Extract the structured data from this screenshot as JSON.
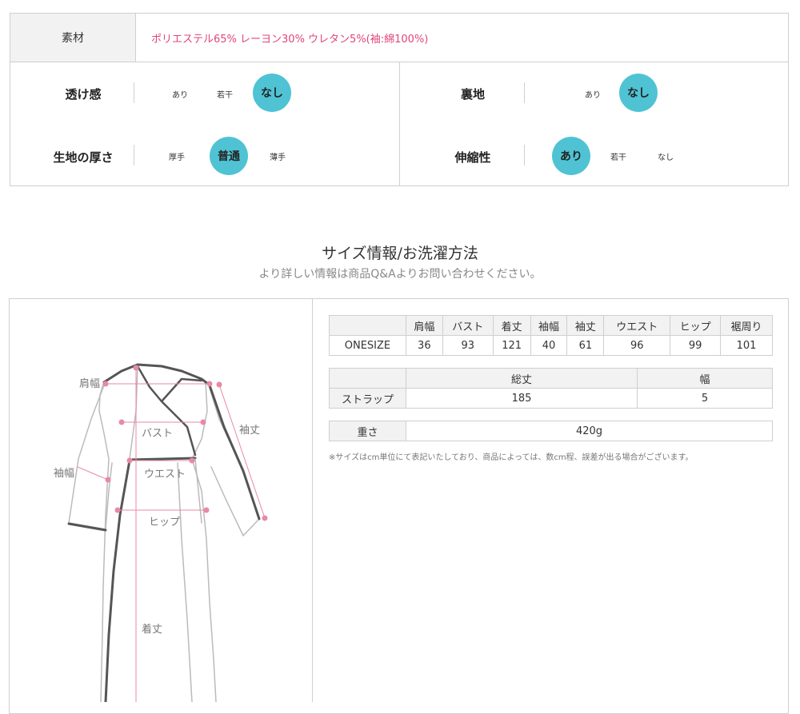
{
  "material": {
    "label": "素材",
    "value": "ポリエステル65% レーヨン30% ウレタン5%(袖:綿100%)"
  },
  "properties": {
    "transparency": {
      "label": "透け感",
      "options": [
        "あり",
        "若干",
        "なし"
      ],
      "selected": "なし"
    },
    "lining": {
      "label": "裏地",
      "options": [
        "あり",
        "なし"
      ],
      "selected": "なし"
    },
    "thickness": {
      "label": "生地の厚さ",
      "options": [
        "厚手",
        "普通",
        "薄手"
      ],
      "selected": "普通"
    },
    "stretch": {
      "label": "伸縮性",
      "options": [
        "あり",
        "若干",
        "なし"
      ],
      "selected": "あり"
    }
  },
  "size_section": {
    "title": "サイズ情報/お洗濯方法",
    "subtitle": "より詳しい情報は商品Q&Aよりお問い合わせください。"
  },
  "size_table": {
    "headers": [
      "",
      "肩幅",
      "バスト",
      "着丈",
      "袖幅",
      "袖丈",
      "ウエスト",
      "ヒップ",
      "裾周り"
    ],
    "rows": [
      [
        "ONESIZE",
        "36",
        "93",
        "121",
        "40",
        "61",
        "96",
        "99",
        "101"
      ]
    ]
  },
  "strap_table": {
    "headers": [
      "",
      "総丈",
      "幅"
    ],
    "rows": [
      [
        "ストラップ",
        "185",
        "5"
      ]
    ]
  },
  "weight": {
    "label": "重さ",
    "value": "420g"
  },
  "note": "※サイズはcm単位にて表記いたしており、商品によっては、数cm程、誤差が出る場合がございます。",
  "diagram_labels": {
    "shoulder": "肩幅",
    "sleeve_length": "袖丈",
    "bust": "バスト",
    "sleeve_width": "袖幅",
    "waist": "ウエスト",
    "hip": "ヒップ",
    "length": "着丈"
  },
  "colors": {
    "accent": "#4fc3d4",
    "material_text": "#e0457b",
    "measure": "#e88aa4"
  }
}
